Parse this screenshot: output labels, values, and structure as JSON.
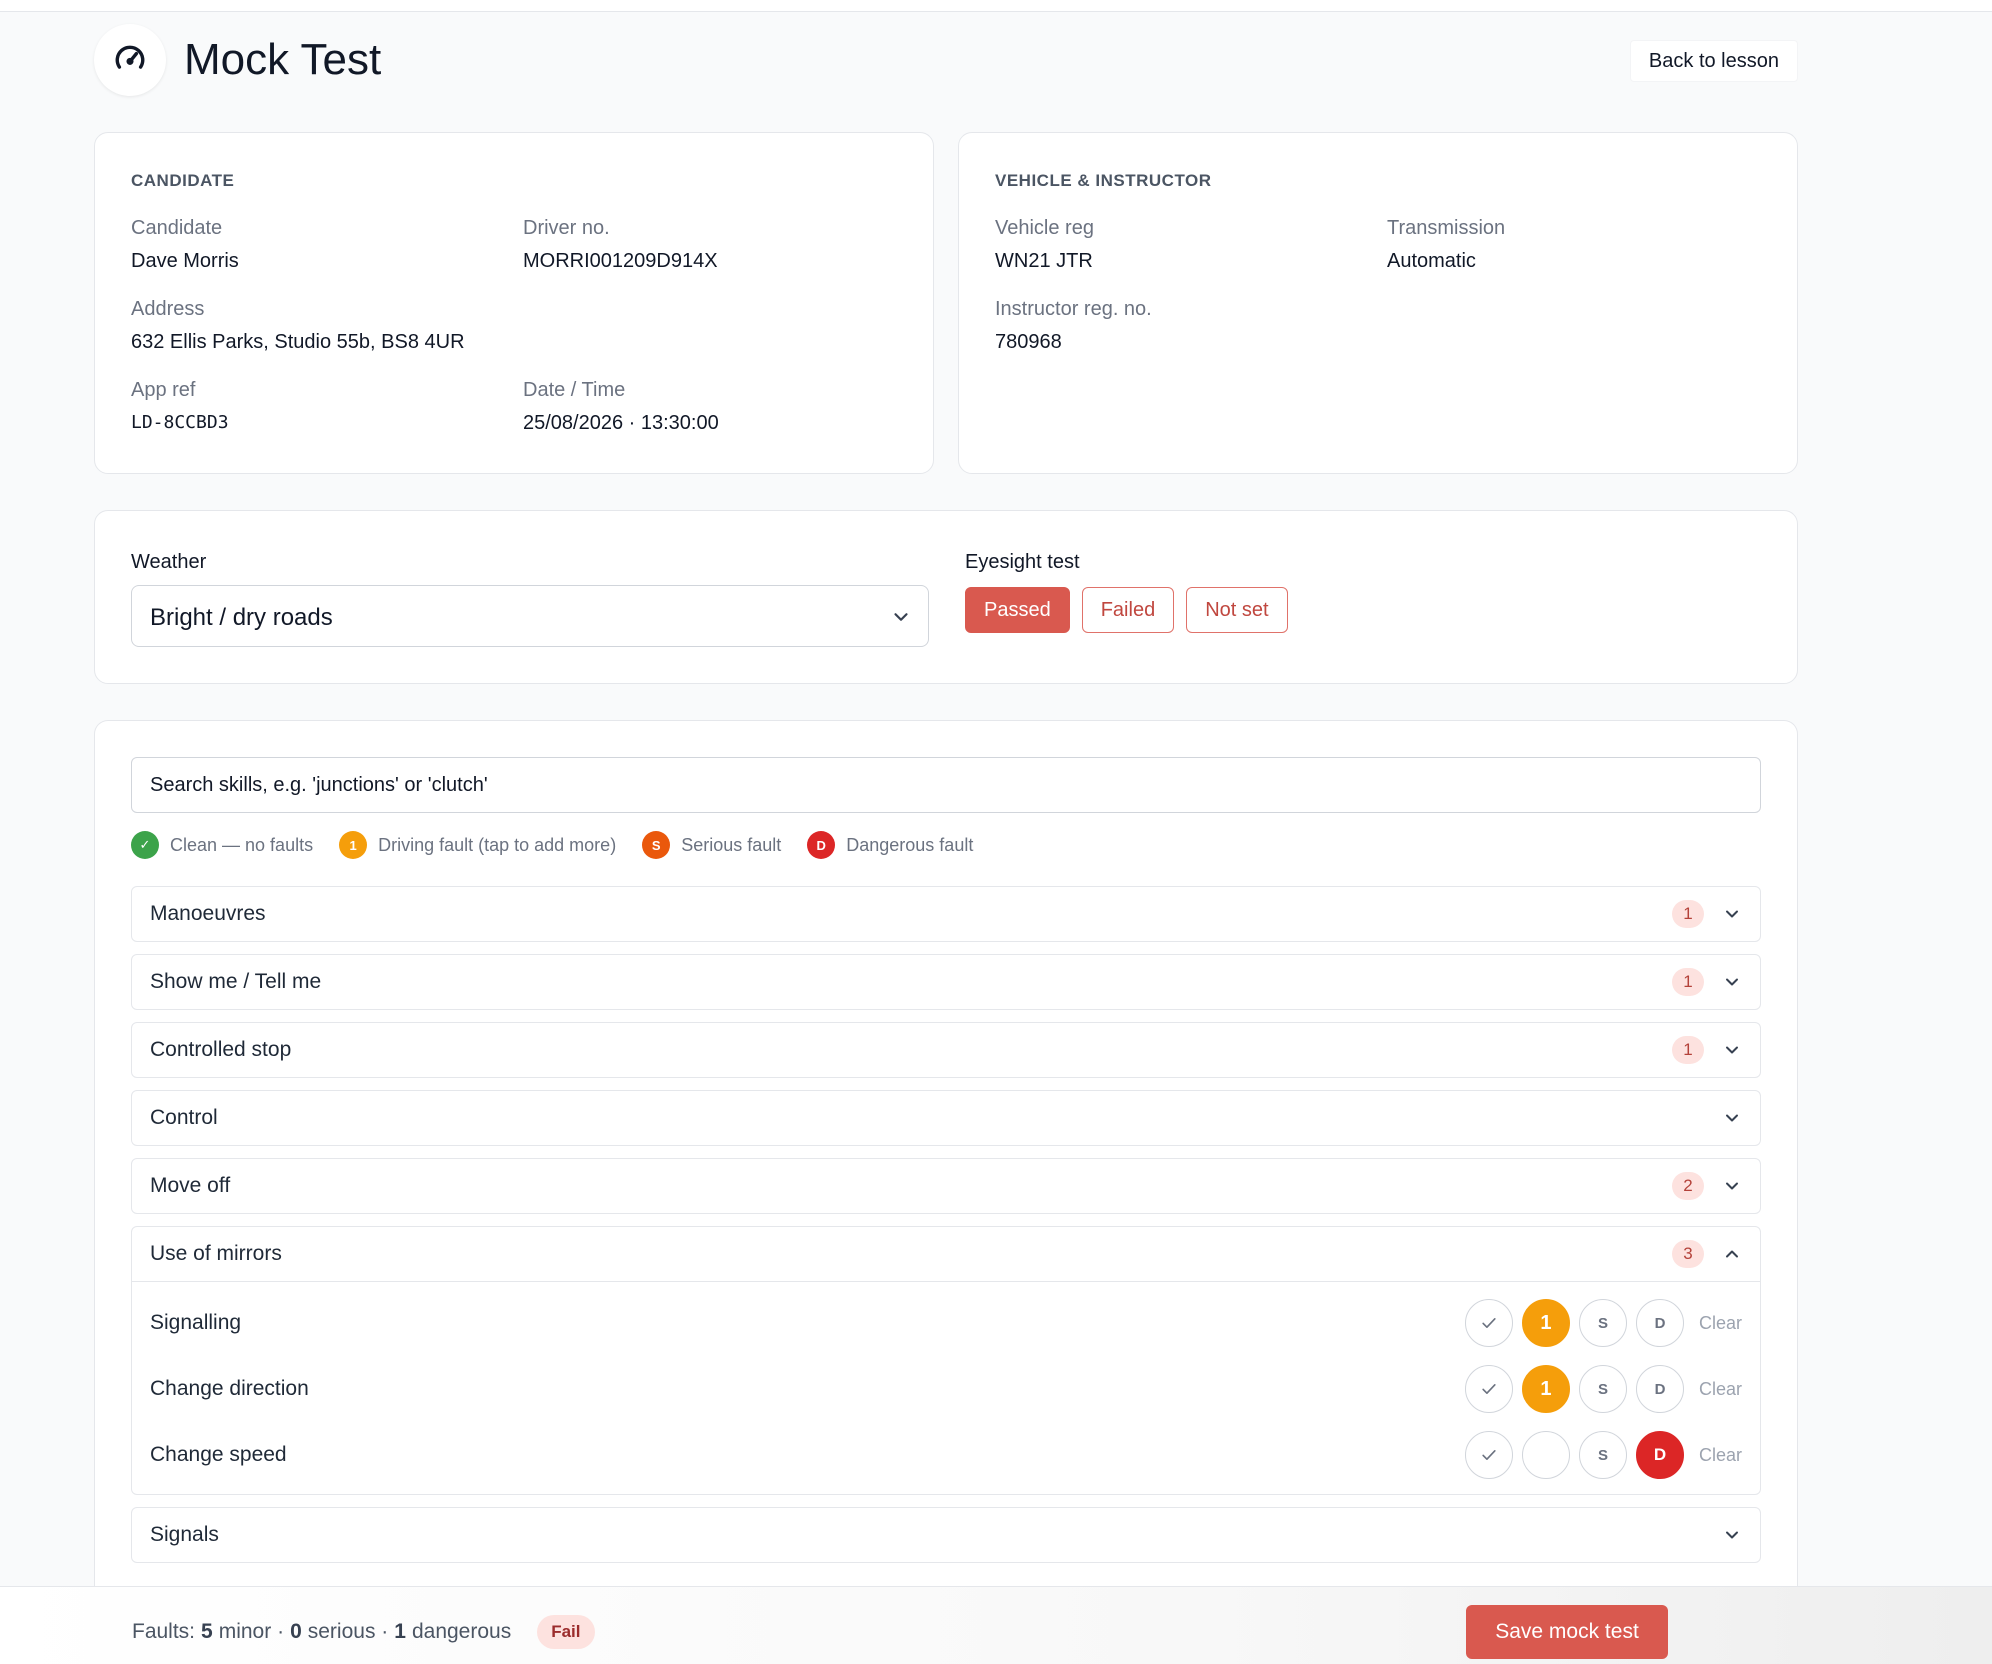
{
  "header": {
    "title": "Mock Test",
    "back_label": "Back to lesson",
    "logo_icon": "speedometer-icon"
  },
  "candidate": {
    "section": "CANDIDATE",
    "name_label": "Candidate",
    "name": "Dave Morris",
    "driver_label": "Driver no.",
    "driver_no": "MORRI001209D914X",
    "address_label": "Address",
    "address": "632 Ellis Parks, Studio 55b, BS8 4UR",
    "appref_label": "App ref",
    "appref": "LD-8CCBD3",
    "datetime_label": "Date / Time",
    "datetime": "25/08/2026 · 13:30:00"
  },
  "vehicle": {
    "section": "VEHICLE & INSTRUCTOR",
    "reg_label": "Vehicle reg",
    "reg": "WN21 JTR",
    "transmission_label": "Transmission",
    "transmission": "Automatic",
    "instructor_label": "Instructor reg. no.",
    "instructor": "780968"
  },
  "conditions": {
    "weather_label": "Weather",
    "weather_value": "Bright / dry roads",
    "eyesight_label": "Eyesight test",
    "eyesight_options": [
      "Passed",
      "Failed",
      "Not set"
    ],
    "eyesight_selected": "Passed"
  },
  "skills": {
    "search_placeholder": "Search skills, e.g. 'junctions' or 'clutch'",
    "legend": [
      {
        "glyph": "✓",
        "text": "Clean — no faults",
        "color": "#3ca34a"
      },
      {
        "glyph": "1",
        "text": "Driving fault (tap to add more)",
        "color": "#f59e0b"
      },
      {
        "glyph": "S",
        "text": "Serious fault",
        "color": "#ea580c"
      },
      {
        "glyph": "D",
        "text": "Dangerous fault",
        "color": "#dc2626"
      }
    ],
    "sections": [
      {
        "title": "Manoeuvres",
        "count": "1"
      },
      {
        "title": "Show me / Tell me",
        "count": "1"
      },
      {
        "title": "Controlled stop",
        "count": "1"
      },
      {
        "title": "Control",
        "count": ""
      },
      {
        "title": "Move off",
        "count": "2"
      },
      {
        "title": "Use of mirrors",
        "count": "3",
        "expanded": true,
        "items": [
          {
            "name": "Signalling",
            "minor": "1",
            "serious": false,
            "dangerous": false
          },
          {
            "name": "Change direction",
            "minor": "1",
            "serious": false,
            "dangerous": false
          },
          {
            "name": "Change speed",
            "minor": "",
            "serious": false,
            "dangerous": true
          }
        ]
      },
      {
        "title": "Signals",
        "count": ""
      }
    ],
    "fault_labels": {
      "clean": "✓",
      "serious": "S",
      "dangerous": "D",
      "clear": "Clear"
    }
  },
  "footer": {
    "faults_prefix": "Faults:",
    "minor_count": "5",
    "minor_label": "minor ·",
    "serious_count": "0",
    "serious_label": "serious ·",
    "dangerous_count": "1",
    "dangerous_label": "dangerous",
    "result": "Fail",
    "save_label": "Save mock test"
  },
  "colors": {
    "accent": "#d9594f",
    "minor": "#f59e0b",
    "dangerous": "#dc2626",
    "badge_bg": "#fde2df"
  }
}
